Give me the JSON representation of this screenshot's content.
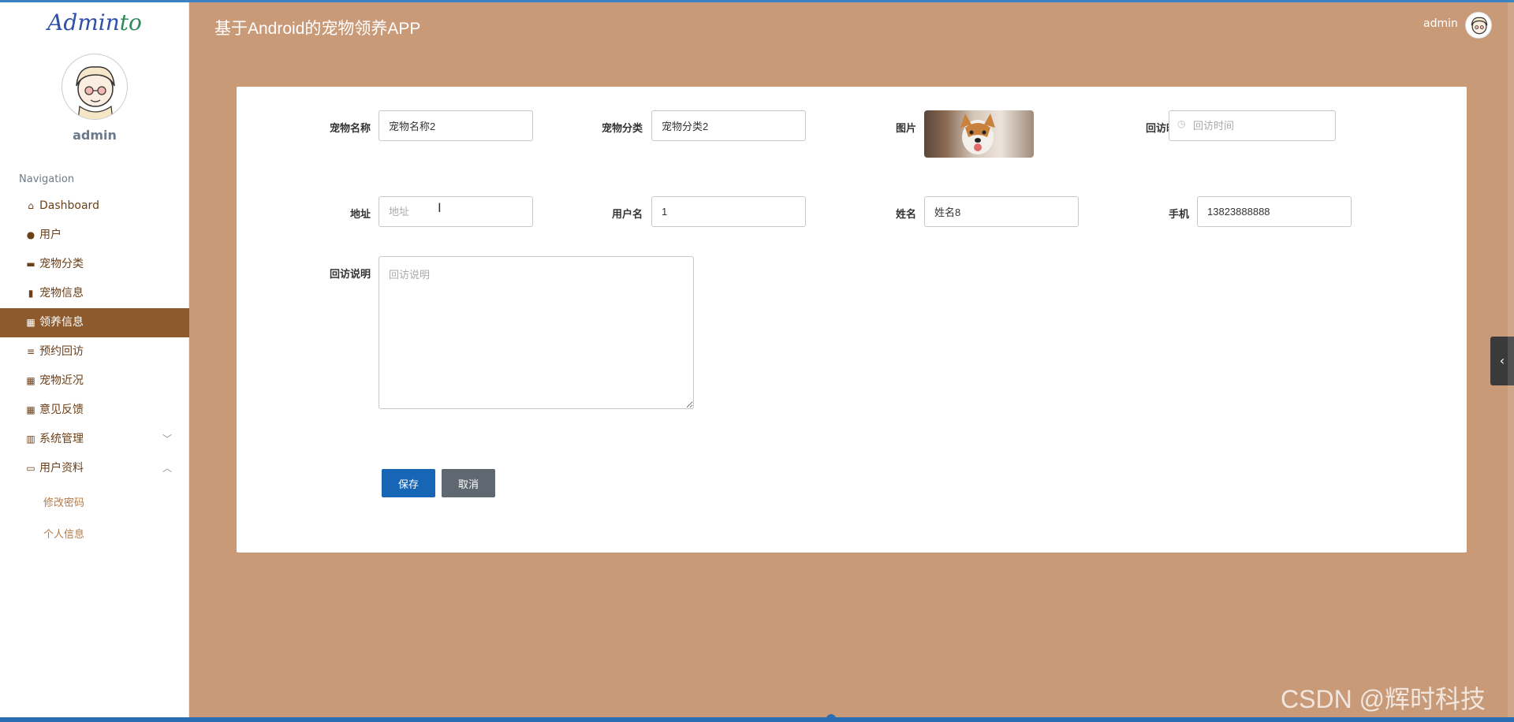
{
  "brand": {
    "part1": "Admin",
    "part2": "to"
  },
  "sidebar": {
    "username": "admin",
    "nav_title": "Navigation",
    "items": [
      {
        "label": "Dashboard",
        "icon": "home-icon"
      },
      {
        "label": "用户",
        "icon": "pin-icon"
      },
      {
        "label": "宠物分类",
        "icon": "monitor-icon"
      },
      {
        "label": "宠物信息",
        "icon": "bar-chart-icon"
      },
      {
        "label": "领养信息",
        "icon": "grid-icon"
      },
      {
        "label": "预约回访",
        "icon": "list-icon"
      },
      {
        "label": "宠物近况",
        "icon": "grid-icon"
      },
      {
        "label": "意见反馈",
        "icon": "grid-icon"
      },
      {
        "label": "系统管理",
        "icon": "book-icon"
      },
      {
        "label": "用户资料",
        "icon": "card-icon"
      }
    ],
    "active_item": "领养信息",
    "submenu": [
      {
        "label": "修改密码"
      },
      {
        "label": "个人信息"
      }
    ]
  },
  "header": {
    "title": "基于Android的宠物领养APP",
    "user": "admin"
  },
  "form": {
    "pet_name": {
      "label": "宠物名称",
      "value": "宠物名称2"
    },
    "pet_category": {
      "label": "宠物分类",
      "value": "宠物分类2"
    },
    "image": {
      "label": "图片"
    },
    "visit_time": {
      "label": "回访时间",
      "placeholder": "回访时间"
    },
    "address": {
      "label": "地址",
      "placeholder": "地址"
    },
    "username": {
      "label": "用户名",
      "value": "1"
    },
    "name": {
      "label": "姓名",
      "value": "姓名8"
    },
    "phone": {
      "label": "手机",
      "value": "13823888888"
    },
    "visit_note": {
      "label": "回访说明",
      "placeholder": "回访说明"
    },
    "save_label": "保存",
    "cancel_label": "取消"
  },
  "watermark": "CSDN @辉时科技",
  "colors": {
    "accent": "#8d5a2e",
    "primary_button": "#1765b5",
    "secondary_button": "#5f6770",
    "background": "#c89a78"
  }
}
